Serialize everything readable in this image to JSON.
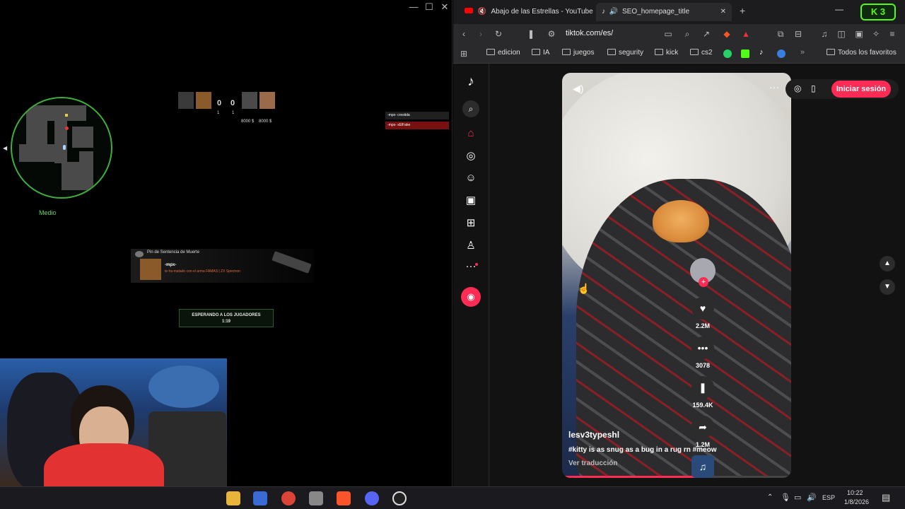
{
  "game": {
    "window_controls": [
      "—",
      "☐",
      "✕"
    ],
    "radar_label": "Medio",
    "scoreboard": {
      "team_left_score": "0",
      "team_right_score": "0",
      "money_left": "8000 $",
      "money_right": "8000 $",
      "kills_left": "0",
      "kills_right": "1",
      "sub_left": "1",
      "sub_right": "1"
    },
    "killfeed": [
      {
        "text": "-mpx-  crestida"
      },
      {
        "text": "-mpx-  xElFake"
      }
    ],
    "death_card": {
      "title": "Pin de Sentencia de Muerte",
      "killer": "-mpx-",
      "message": "te ha matado con el arma FAMAS | ZX Spectron"
    },
    "waiting": {
      "label": "ESPERANDO A LOS JUGADORES",
      "timer": "1:19"
    }
  },
  "browser": {
    "tabs": [
      {
        "label": "Abajo de las Estrellas - YouTube",
        "active": false
      },
      {
        "label": "SEO_homepage_title",
        "active": true
      }
    ],
    "new_tab": "+",
    "address": "tiktok.com/es/",
    "extension_badge": "3",
    "bookmarks": [
      {
        "label": "edicion",
        "type": "folder"
      },
      {
        "label": "IA",
        "type": "folder"
      },
      {
        "label": "juegos",
        "type": "folder"
      },
      {
        "label": "segurity",
        "type": "folder"
      },
      {
        "label": "kick",
        "type": "folder"
      },
      {
        "label": "cs2",
        "type": "folder"
      }
    ],
    "bookmarks_more": "»",
    "all_bookmarks": "Todos los favoritos"
  },
  "tiktok": {
    "login_label": "Iniciar sesión",
    "video": {
      "author": "lesv3typeshl",
      "caption": "#kitty is as snug as a bug in a rug rn #meow",
      "translate": "Ver traducción",
      "progress_fraction": 0.58
    },
    "actions": {
      "likes": "2.2M",
      "comments": "3078",
      "saves": "159.4K",
      "shares": "1.2M"
    }
  },
  "taskbar": {
    "language": "ESP",
    "time": "10:22",
    "date": "1/8/2026"
  },
  "colors": {
    "tiktok_red": "#fe2c55",
    "radar_green": "#3fae3f",
    "browser_dark": "#1c1c1e"
  }
}
